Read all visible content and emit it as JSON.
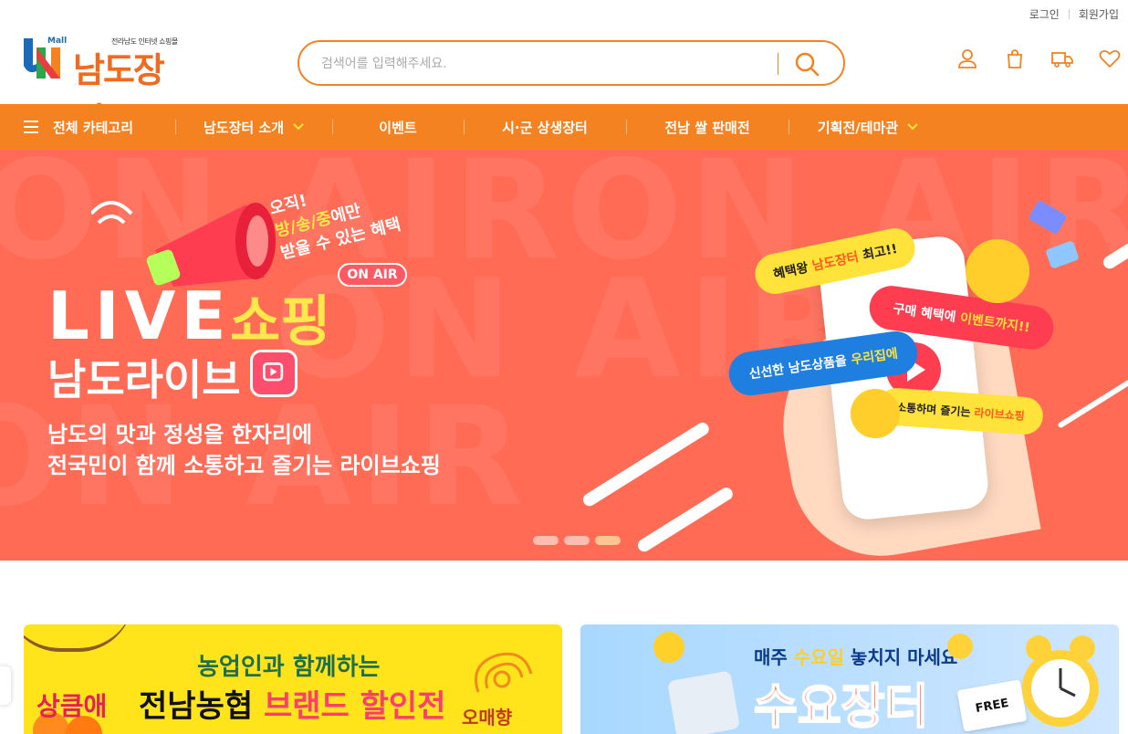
{
  "top_links": {
    "login": "로그인",
    "signup": "회원가입"
  },
  "logo": {
    "mall_badge": "Mall",
    "tagline": "전라남도 인터넷 쇼핑몰",
    "name": "남도장터"
  },
  "search": {
    "placeholder": "검색어를 입력해주세요."
  },
  "header_icons": [
    "user-icon",
    "cart-icon",
    "delivery-truck-icon",
    "heart-icon"
  ],
  "nav": {
    "all_categories": "전체 카테고리",
    "items": [
      {
        "label": "남도장터 소개",
        "has_dropdown": true
      },
      {
        "label": "이벤트",
        "has_dropdown": false
      },
      {
        "label": "시·군 상생장터",
        "has_dropdown": false
      },
      {
        "label": "전남 쌀 판매전",
        "has_dropdown": false
      },
      {
        "label": "기획전/테마관",
        "has_dropdown": true
      }
    ]
  },
  "banner": {
    "bg_text": "ON AIR",
    "headline_small_1": "오직!",
    "headline_small_2a": "방/송/중",
    "headline_small_2b": "에만",
    "headline_small_3": "받을 수 있는 혜택",
    "on_air_badge": "ON AIR",
    "live": "LIVE",
    "shopping": "쇼핑",
    "namdo_live": "남도라이브",
    "sub_line_1": "남도의 맛과 정성을 한자리에",
    "sub_line_2": "전국민이 함께 소통하고 즐기는 라이브쇼핑",
    "bubbles": {
      "b1_a": "혜택왕 ",
      "b1_b": "남도장터",
      "b1_c": " 최고!!",
      "b2_a": "구매 혜택에 ",
      "b2_b": "이벤트까지!!",
      "b3_a": "신선한 남도상품을 ",
      "b3_b": "우리집에",
      "b4_a": "소통하며 즐기는 ",
      "b4_b": "라이브쇼핑"
    },
    "slides_total": 3,
    "active_slide": 3
  },
  "promos": [
    {
      "line_1": "농업인과 함께하는",
      "line_2a": "전남농협 ",
      "line_2b": "브랜드 할인전",
      "brand": "상큼애",
      "brand_right": "오매향"
    },
    {
      "line_1a": "매주 ",
      "line_1b": "수요일",
      "line_1c": " 놓치지 마세요",
      "line_2": "수요장터",
      "coupon": "FREE"
    }
  ],
  "colors": {
    "accent": "#f58220",
    "banner_bg": "#ff6b55",
    "promo1_bg": "#ffe41b",
    "promo2_bg": "#bfe0ff"
  }
}
